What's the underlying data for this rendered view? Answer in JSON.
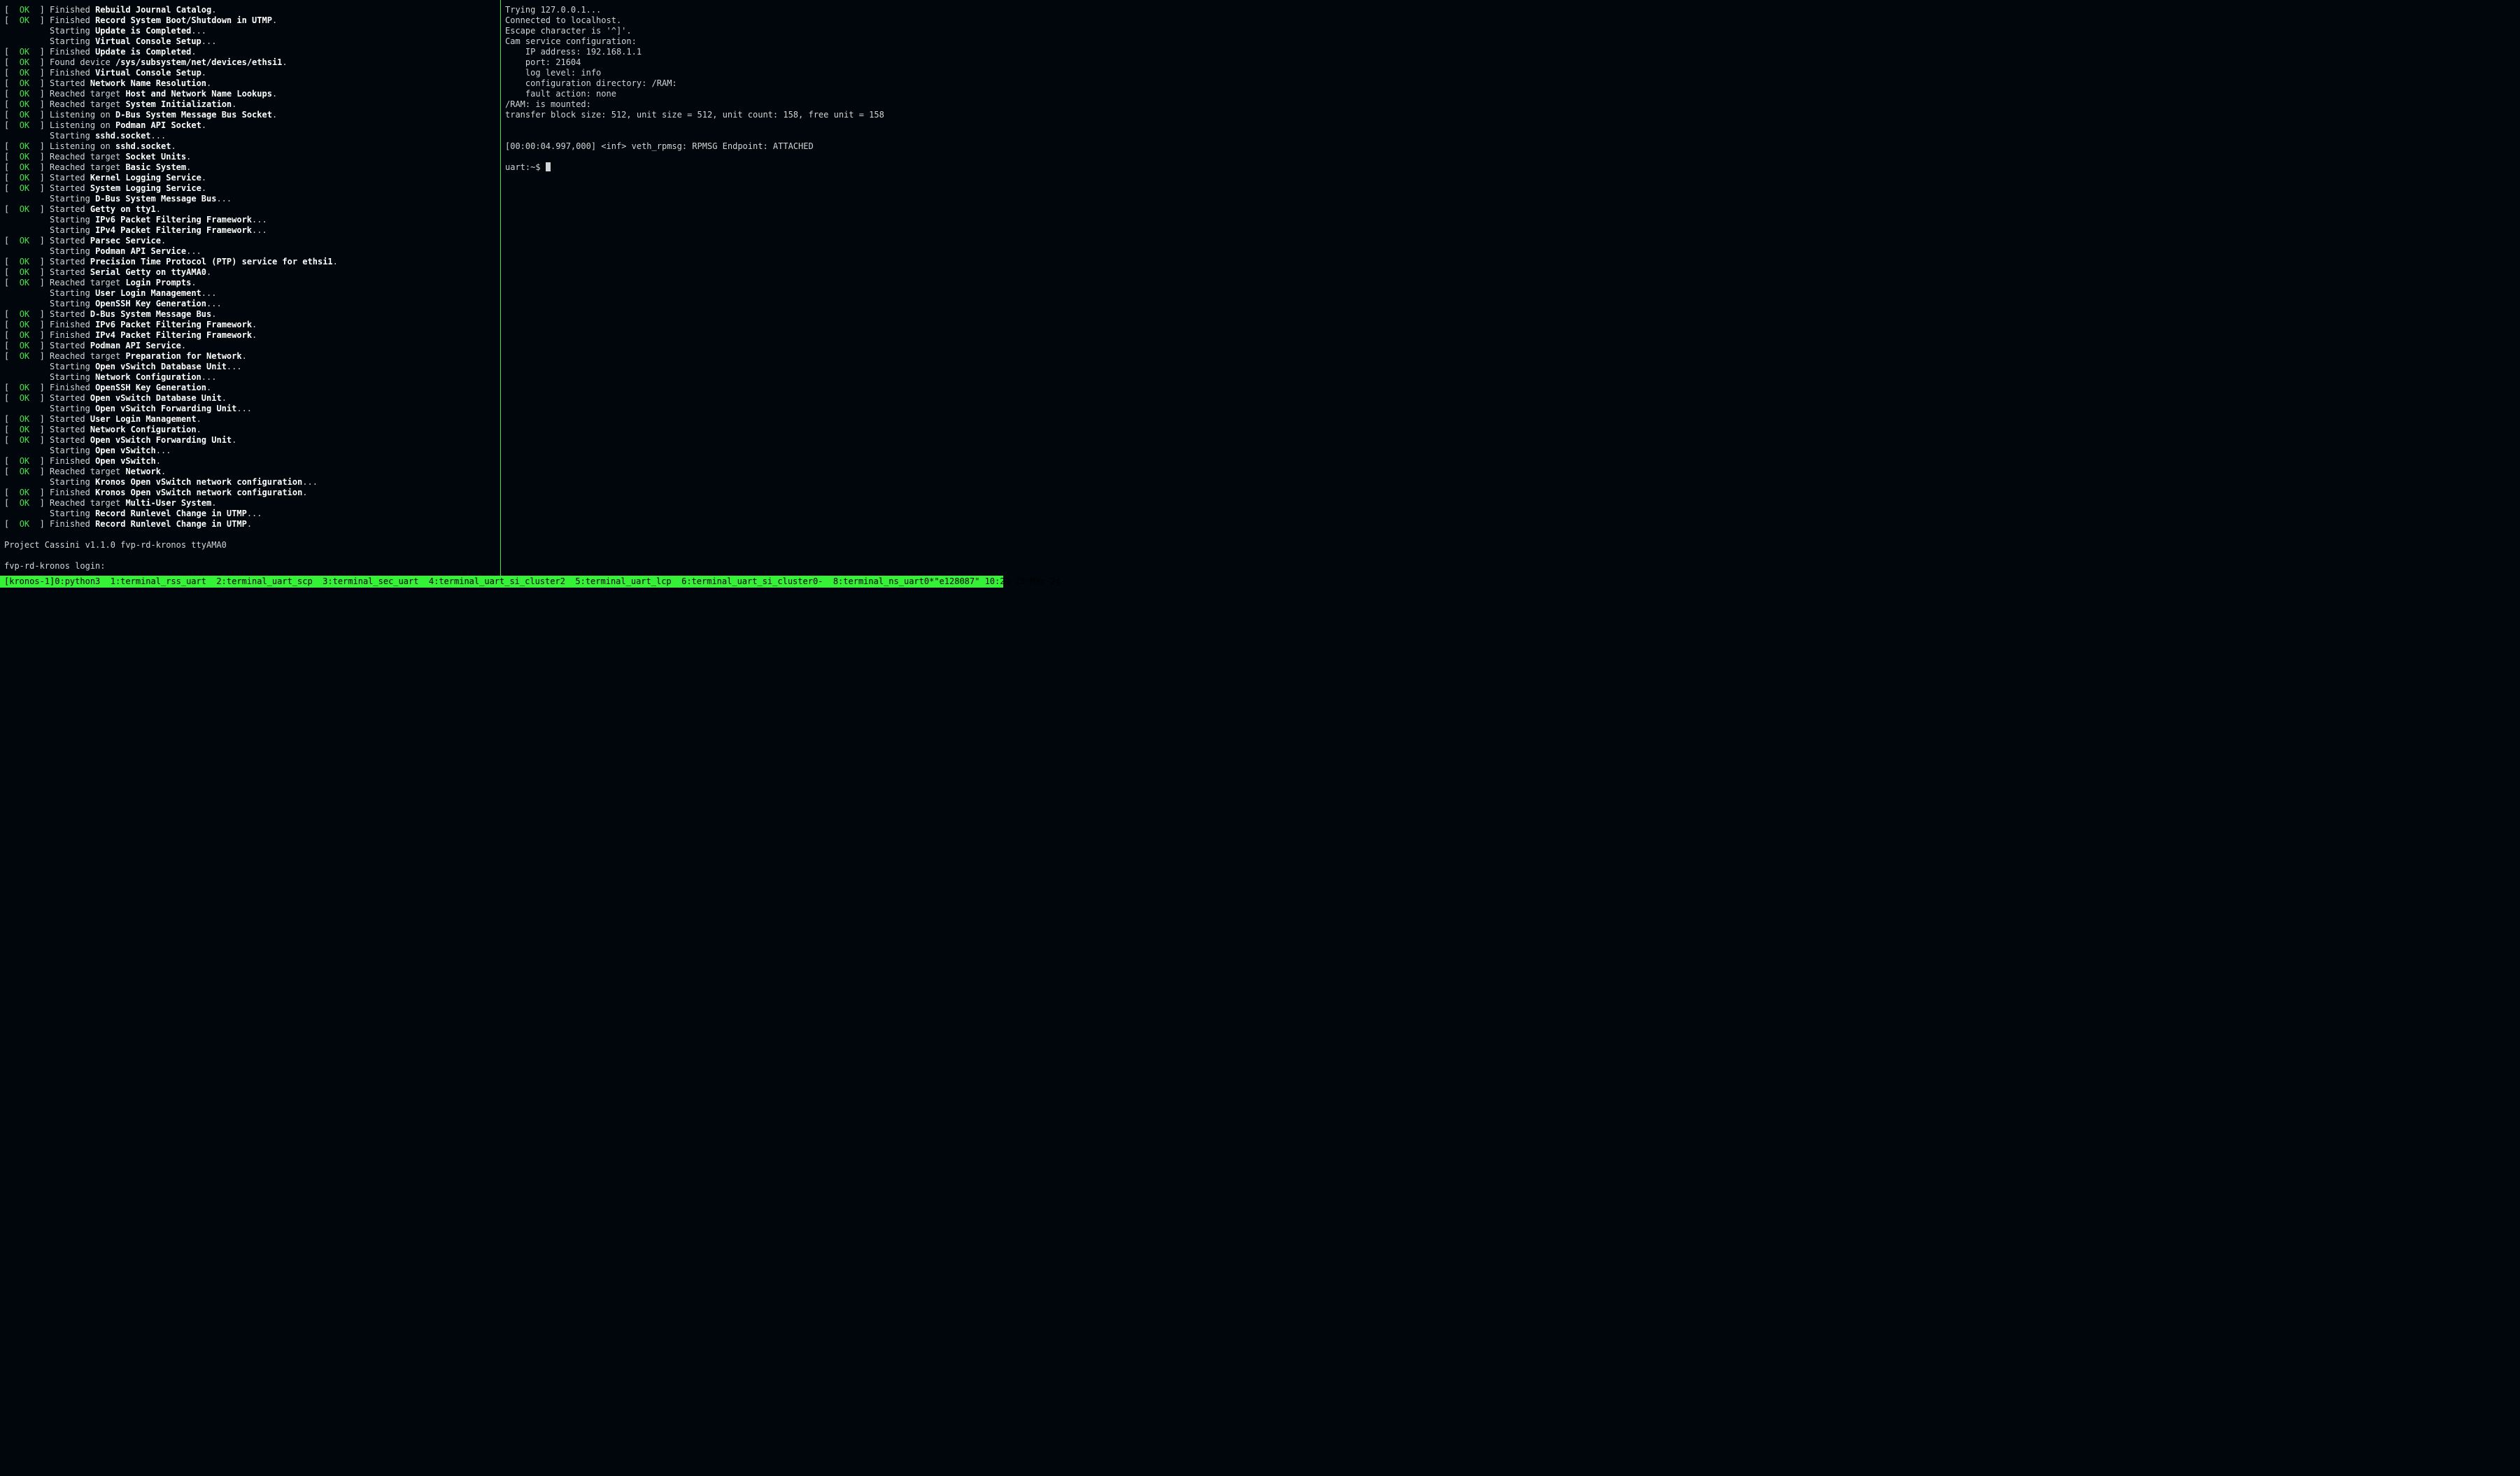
{
  "left_pane": {
    "lines": [
      {
        "status": "OK",
        "verb": "Finished",
        "subject": "Rebuild Journal Catalog",
        "suffix": "."
      },
      {
        "status": "OK",
        "verb": "Finished",
        "subject": "Record System Boot/Shutdown in UTMP",
        "suffix": "."
      },
      {
        "status": null,
        "verb": "Starting",
        "subject": "Update is Completed",
        "suffix": "..."
      },
      {
        "status": null,
        "verb": "Starting",
        "subject": "Virtual Console Setup",
        "suffix": "..."
      },
      {
        "status": "OK",
        "verb": "Finished",
        "subject": "Update is Completed",
        "suffix": "."
      },
      {
        "status": "OK",
        "verb": "Found device",
        "subject": "/sys/subsystem/net/devices/ethsi1",
        "suffix": "."
      },
      {
        "status": "OK",
        "verb": "Finished",
        "subject": "Virtual Console Setup",
        "suffix": "."
      },
      {
        "status": "OK",
        "verb": "Started",
        "subject": "Network Name Resolution",
        "suffix": "."
      },
      {
        "status": "OK",
        "verb": "Reached target",
        "subject": "Host and Network Name Lookups",
        "suffix": "."
      },
      {
        "status": "OK",
        "verb": "Reached target",
        "subject": "System Initialization",
        "suffix": "."
      },
      {
        "status": "OK",
        "verb": "Listening on",
        "subject": "D-Bus System Message Bus Socket",
        "suffix": "."
      },
      {
        "status": "OK",
        "verb": "Listening on",
        "subject": "Podman API Socket",
        "suffix": "."
      },
      {
        "status": null,
        "verb": "Starting",
        "subject": "sshd.socket",
        "suffix": "..."
      },
      {
        "status": "OK",
        "verb": "Listening on",
        "subject": "sshd.socket",
        "suffix": "."
      },
      {
        "status": "OK",
        "verb": "Reached target",
        "subject": "Socket Units",
        "suffix": "."
      },
      {
        "status": "OK",
        "verb": "Reached target",
        "subject": "Basic System",
        "suffix": "."
      },
      {
        "status": "OK",
        "verb": "Started",
        "subject": "Kernel Logging Service",
        "suffix": "."
      },
      {
        "status": "OK",
        "verb": "Started",
        "subject": "System Logging Service",
        "suffix": "."
      },
      {
        "status": null,
        "verb": "Starting",
        "subject": "D-Bus System Message Bus",
        "suffix": "..."
      },
      {
        "status": "OK",
        "verb": "Started",
        "subject": "Getty on tty1",
        "suffix": "."
      },
      {
        "status": null,
        "verb": "Starting",
        "subject": "IPv6 Packet Filtering Framework",
        "suffix": "..."
      },
      {
        "status": null,
        "verb": "Starting",
        "subject": "IPv4 Packet Filtering Framework",
        "suffix": "..."
      },
      {
        "status": "OK",
        "verb": "Started",
        "subject": "Parsec Service",
        "suffix": "."
      },
      {
        "status": null,
        "verb": "Starting",
        "subject": "Podman API Service",
        "suffix": "..."
      },
      {
        "status": "OK",
        "verb": "Started",
        "subject": "Precision Time Protocol (PTP) service for ethsi1",
        "suffix": "."
      },
      {
        "status": "OK",
        "verb": "Started",
        "subject": "Serial Getty on ttyAMA0",
        "suffix": "."
      },
      {
        "status": "OK",
        "verb": "Reached target",
        "subject": "Login Prompts",
        "suffix": "."
      },
      {
        "status": null,
        "verb": "Starting",
        "subject": "User Login Management",
        "suffix": "..."
      },
      {
        "status": null,
        "verb": "Starting",
        "subject": "OpenSSH Key Generation",
        "suffix": "..."
      },
      {
        "status": "OK",
        "verb": "Started",
        "subject": "D-Bus System Message Bus",
        "suffix": "."
      },
      {
        "status": "OK",
        "verb": "Finished",
        "subject": "IPv6 Packet Filtering Framework",
        "suffix": "."
      },
      {
        "status": "OK",
        "verb": "Finished",
        "subject": "IPv4 Packet Filtering Framework",
        "suffix": "."
      },
      {
        "status": "OK",
        "verb": "Started",
        "subject": "Podman API Service",
        "suffix": "."
      },
      {
        "status": "OK",
        "verb": "Reached target",
        "subject": "Preparation for Network",
        "suffix": "."
      },
      {
        "status": null,
        "verb": "Starting",
        "subject": "Open vSwitch Database Unit",
        "suffix": "..."
      },
      {
        "status": null,
        "verb": "Starting",
        "subject": "Network Configuration",
        "suffix": "..."
      },
      {
        "status": "OK",
        "verb": "Finished",
        "subject": "OpenSSH Key Generation",
        "suffix": "."
      },
      {
        "status": "OK",
        "verb": "Started",
        "subject": "Open vSwitch Database Unit",
        "suffix": "."
      },
      {
        "status": null,
        "verb": "Starting",
        "subject": "Open vSwitch Forwarding Unit",
        "suffix": "..."
      },
      {
        "status": "OK",
        "verb": "Started",
        "subject": "User Login Management",
        "suffix": "."
      },
      {
        "status": "OK",
        "verb": "Started",
        "subject": "Network Configuration",
        "suffix": "."
      },
      {
        "status": "OK",
        "verb": "Started",
        "subject": "Open vSwitch Forwarding Unit",
        "suffix": "."
      },
      {
        "status": null,
        "verb": "Starting",
        "subject": "Open vSwitch",
        "suffix": "..."
      },
      {
        "status": "OK",
        "verb": "Finished",
        "subject": "Open vSwitch",
        "suffix": "."
      },
      {
        "status": "OK",
        "verb": "Reached target",
        "subject": "Network",
        "suffix": "."
      },
      {
        "status": null,
        "verb": "Starting",
        "subject": "Kronos Open vSwitch network configuration",
        "suffix": "..."
      },
      {
        "status": "OK",
        "verb": "Finished",
        "subject": "Kronos Open vSwitch network configuration",
        "suffix": "."
      },
      {
        "status": "OK",
        "verb": "Reached target",
        "subject": "Multi-User System",
        "suffix": "."
      },
      {
        "status": null,
        "verb": "Starting",
        "subject": "Record Runlevel Change in UTMP",
        "suffix": "..."
      },
      {
        "status": "OK",
        "verb": "Finished",
        "subject": "Record Runlevel Change in UTMP",
        "suffix": "."
      }
    ],
    "banner": "Project Cassini v1.1.0 fvp-rd-kronos ttyAMA0",
    "login": "fvp-rd-kronos login:"
  },
  "right_pane": {
    "lines": [
      "Trying 127.0.0.1...",
      "Connected to localhost.",
      "Escape character is '^]'.",
      "Cam service configuration:",
      "    IP address: 192.168.1.1",
      "    port: 21604",
      "    log level: info",
      "    configuration directory: /RAM:",
      "    fault action: none",
      "/RAM: is mounted:",
      "transfer block size: 512, unit size = 512, unit count: 158, free unit = 158",
      "",
      "",
      "[00:00:04.997,000] <inf> veth_rpmsg: RPMSG Endpoint: ATTACHED",
      ""
    ],
    "prompt": "uart:~$ "
  },
  "status": {
    "session": "[kronos-1]",
    "windows": [
      "0:python3",
      "1:terminal_rss_uart",
      "2:terminal_uart_scp",
      "3:terminal_sec_uart",
      "4:terminal_uart_si_cluster2",
      "5:terminal_uart_lcp",
      "6:terminal_uart_si_cluster0-",
      "8:terminal_ns_uart0*"
    ],
    "host": "\"e128087\"",
    "clock": "10:20 13-Mar-24"
  }
}
